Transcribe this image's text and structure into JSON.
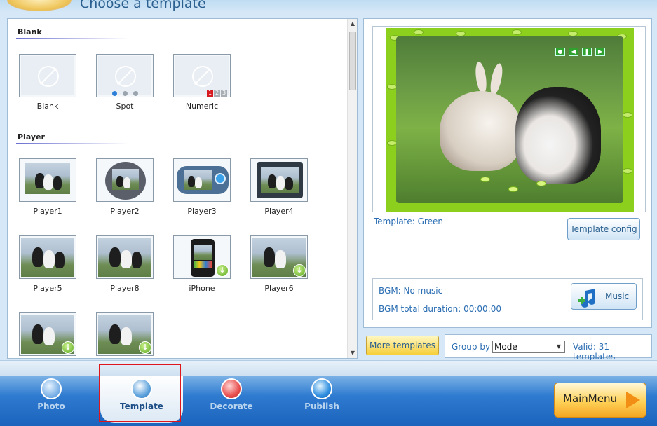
{
  "header": {
    "title": "Choose a template"
  },
  "left_panel": {
    "sections": [
      {
        "heading": "Blank",
        "items": [
          {
            "label": "Blank",
            "type": "blank"
          },
          {
            "label": "Spot",
            "type": "spot"
          },
          {
            "label": "Numeric",
            "type": "numeric",
            "numbers": [
              "1",
              "2",
              "3"
            ]
          }
        ]
      },
      {
        "heading": "Player",
        "items": [
          {
            "label": "Player1"
          },
          {
            "label": "Player2"
          },
          {
            "label": "Player3"
          },
          {
            "label": "Player4"
          },
          {
            "label": "Player5"
          },
          {
            "label": "Player8"
          },
          {
            "label": "iPhone",
            "download": true
          },
          {
            "label": "Player6",
            "download": true
          },
          {
            "label": "",
            "download": true
          },
          {
            "label": "",
            "download": true
          }
        ]
      }
    ]
  },
  "preview": {
    "template_name": "Template: Green",
    "config_button": "Template config",
    "bgm_label": "BGM: No music",
    "bgm_duration": "BGM total duration: 00:00:00",
    "music_button": "Music"
  },
  "toolbar": {
    "more_templates": "More templates",
    "group_by_label": "Group by",
    "group_by_value": "Mode",
    "valid_count": "Valid: 31 templates"
  },
  "nav": {
    "items": [
      {
        "label": "Photo",
        "icon": "photo-icon",
        "active": false
      },
      {
        "label": "Template",
        "icon": "template-icon",
        "active": true
      },
      {
        "label": "Decorate",
        "icon": "decorate-icon",
        "active": false
      },
      {
        "label": "Publish",
        "icon": "publish-icon",
        "active": false
      }
    ],
    "main_menu": "MainMenu"
  },
  "colors": {
    "accent_blue": "#2a6db3",
    "template_green": "#8ccf1c",
    "highlight_red": "#e0141b",
    "main_menu_orange": "#f5a623"
  }
}
